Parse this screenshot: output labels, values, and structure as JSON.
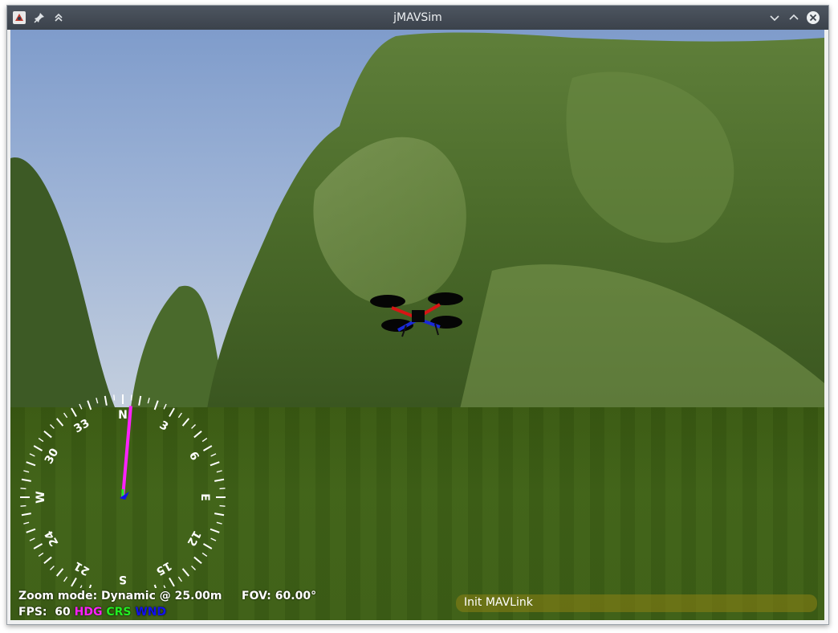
{
  "window": {
    "title": "jMAVSim",
    "titlebar_icons": [
      "app-icon",
      "pin-icon",
      "keep-above-icon"
    ],
    "controls": [
      "minimize-icon",
      "maximize-icon",
      "close-icon"
    ]
  },
  "hud": {
    "zoom_label": "Zoom mode:",
    "zoom_value": "Dynamic @ 25.00m",
    "fov_label": "FOV:",
    "fov_value": "60.00°",
    "fps_label": "FPS:",
    "fps_value": "60",
    "legend": [
      {
        "label": "HDG",
        "color": "#ff22ff"
      },
      {
        "label": "CRS",
        "color": "#22ee22"
      },
      {
        "label": "WND",
        "color": "#1111ee"
      }
    ],
    "status_message": "Init MAVLink"
  },
  "compass": {
    "cardinals": {
      "north": "N",
      "east": "E",
      "south": "S",
      "west": "W"
    },
    "numbers": [
      "3",
      "6",
      "12",
      "15",
      "21",
      "24",
      "30",
      "33"
    ],
    "heading_deg": 5
  },
  "colors": {
    "heading_needle": "#ff22ff",
    "course_arrow": "#22ee22",
    "wind_arrow": "#1111ee"
  }
}
